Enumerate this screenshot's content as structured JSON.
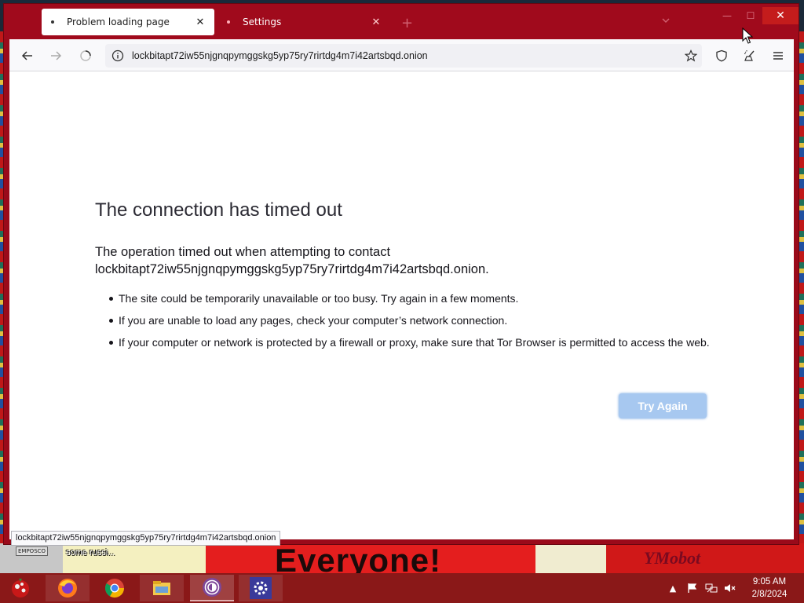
{
  "browser": {
    "tabs": [
      {
        "title": "Problem loading page",
        "active": true
      },
      {
        "title": "Settings",
        "active": false
      }
    ],
    "url": "lockbitapt72iw55njgnqpymggskg5yp75ry7rirtdg4m7i42artsbqd.onion",
    "status_url": "lockbitapt72iw55njgnqpymggskg5yp75ry7rirtdg4m7i42artsbqd.onion"
  },
  "error_page": {
    "title": "The connection has timed out",
    "description_line1": "The operation timed out when attempting to contact",
    "description_line2": "lockbitapt72iw55njgnqpymggskg5yp75ry7rirtdg4m7i42artsbqd.onion.",
    "bullets": [
      "The site could be temporarily unavailable or too busy. Try again in a few moments.",
      "If you are unable to load any pages, check your computer’s network connection.",
      "If your computer or network is protected by a firewall or proxy, make sure that Tor Browser is permitted to access the web."
    ],
    "try_again_label": "Try Again"
  },
  "wallpaper": {
    "banner_text": "Everyone!",
    "caption": "some russi...",
    "sticker": "EMPOSCO",
    "logo_text": "YMobot"
  },
  "taskbar": {
    "apps": [
      "firefox-icon",
      "chrome-icon",
      "file-explorer-icon",
      "tor-browser-icon",
      "settings-icon"
    ],
    "time": "9:05 AM",
    "date": "2/8/2024"
  },
  "colors": {
    "frame": "#a00a1c",
    "taskbar": "#8a1818",
    "button": "#a7c8f0"
  }
}
